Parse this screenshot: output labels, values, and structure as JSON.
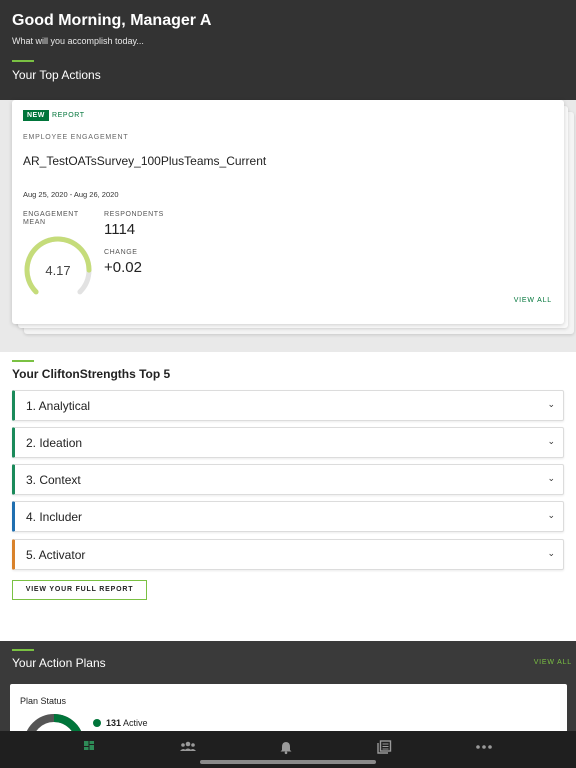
{
  "header": {
    "greeting": "Good Morning, Manager A",
    "subtitle": "What will you accomplish today...",
    "top_actions_title": "Your Top Actions"
  },
  "action_card": {
    "badge_new": "NEW",
    "badge_type": "REPORT",
    "category": "EMPLOYEE ENGAGEMENT",
    "name": "AR_TestOATsSurvey_100PlusTeams_Current",
    "dates": "Aug 25, 2020 - Aug 26, 2020",
    "engagement_label": "ENGAGEMENT MEAN",
    "engagement_mean": "4.17",
    "engagement_scale_max": 5,
    "respondents_label": "RESPONDENTS",
    "respondents": "1114",
    "change_label": "CHANGE",
    "change": "+0.02",
    "view_all": "VIEW ALL"
  },
  "strengths": {
    "title": "Your CliftonStrengths Top 5",
    "items": [
      {
        "label": "1. Analytical",
        "color": "#1a8a5a"
      },
      {
        "label": "2. Ideation",
        "color": "#1a8a5a"
      },
      {
        "label": "3. Context",
        "color": "#1a8a5a"
      },
      {
        "label": "4. Includer",
        "color": "#1f6fb0"
      },
      {
        "label": "5. Activator",
        "color": "#d9822b"
      }
    ],
    "full_report_label": "VIEW YOUR FULL REPORT"
  },
  "action_plans": {
    "title": "Your Action Plans",
    "view_all": "VIEW ALL",
    "plan_status_title": "Plan Status",
    "active_count": "131",
    "active_label": "Active"
  },
  "bottom_nav": {
    "items": [
      "home-icon",
      "team-icon",
      "bell-icon",
      "reports-icon",
      "more-icon"
    ]
  },
  "colors": {
    "brand_green": "#00753a",
    "accent_green": "#7ac143",
    "gauge_green": "#c5dc7a"
  }
}
